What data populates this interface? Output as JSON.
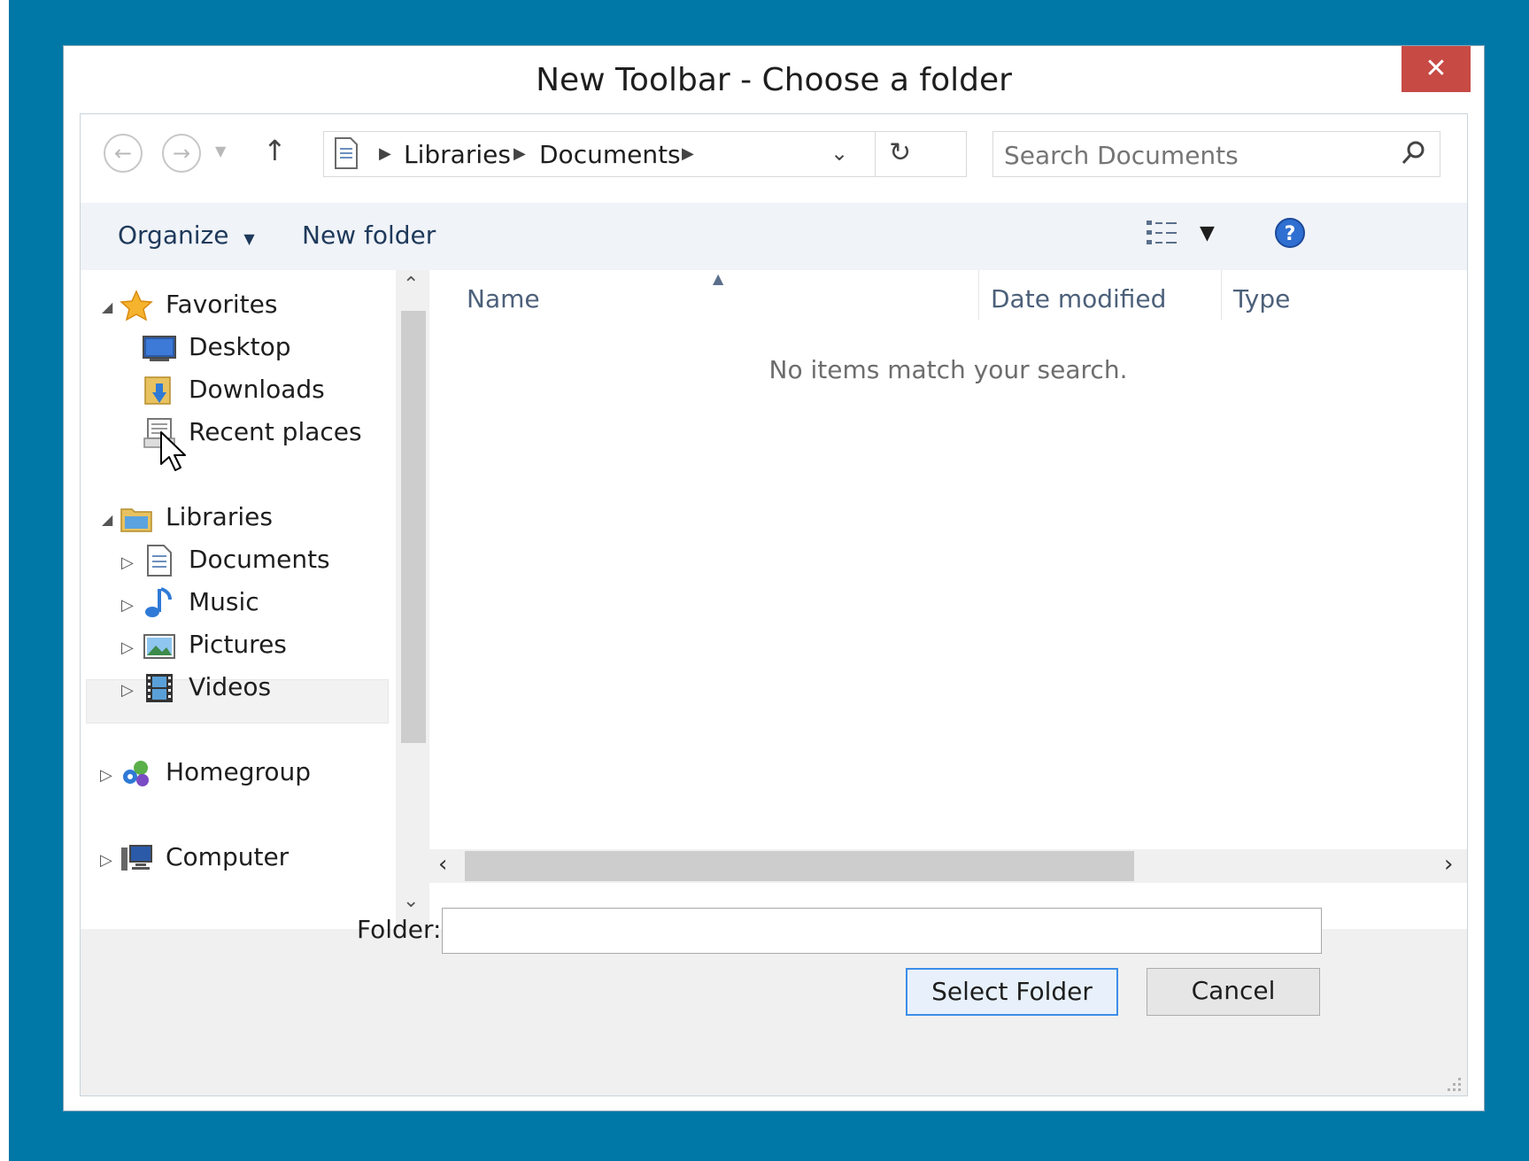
{
  "window": {
    "title": "New Toolbar - Choose a folder",
    "close_label": "✕"
  },
  "address": {
    "crumbs": [
      "Libraries",
      "Documents"
    ]
  },
  "search": {
    "placeholder": "Search Documents"
  },
  "commands": {
    "organize": "Organize",
    "new_folder": "New folder"
  },
  "nav": {
    "favorites": "Favorites",
    "desktop": "Desktop",
    "downloads": "Downloads",
    "recent": "Recent places",
    "libraries": "Libraries",
    "documents": "Documents",
    "music": "Music",
    "pictures": "Pictures",
    "videos": "Videos",
    "homegroup": "Homegroup",
    "computer": "Computer"
  },
  "columns": {
    "name": "Name",
    "date": "Date modified",
    "type": "Type"
  },
  "content": {
    "empty_message": "No items match your search."
  },
  "footer": {
    "folder_label": "Folder:",
    "folder_value": "",
    "select_button": "Select Folder",
    "cancel_button": "Cancel"
  },
  "colors": {
    "desktop": "#0078a7",
    "close": "#c74a45",
    "command_text": "#1e395b",
    "selected_border": "#3c8ee8"
  }
}
